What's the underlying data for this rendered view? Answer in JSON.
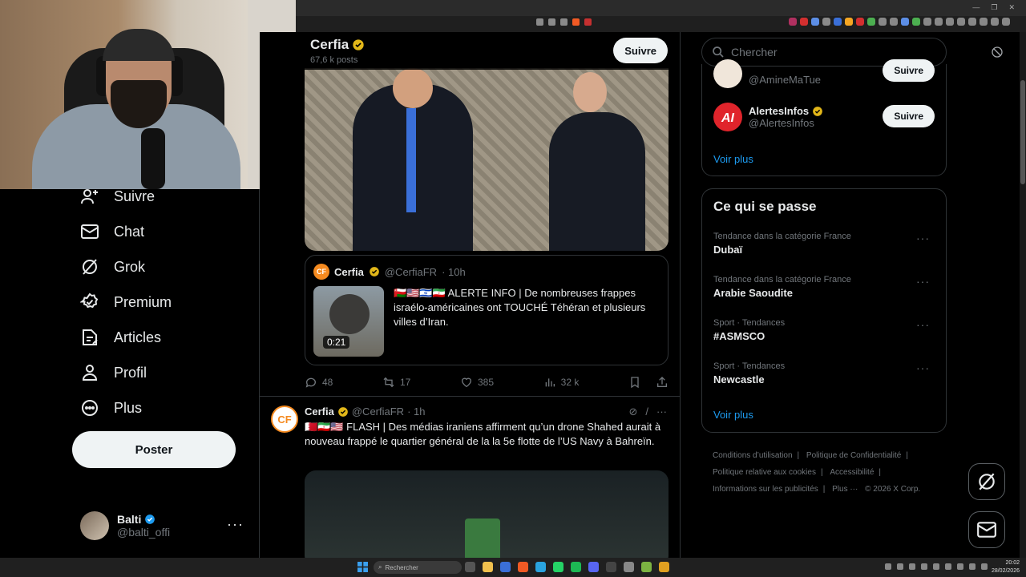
{
  "profile_header": {
    "name": "Cerfia",
    "posts_count": "67,6 k posts",
    "follow_label": "Suivre"
  },
  "nav": {
    "items": [
      {
        "label": "Suivre",
        "icon": "add-user-icon"
      },
      {
        "label": "Chat",
        "icon": "mail-icon"
      },
      {
        "label": "Grok",
        "icon": "grok-icon"
      },
      {
        "label": "Premium",
        "icon": "verified-badge-icon"
      },
      {
        "label": "Articles",
        "icon": "article-icon"
      },
      {
        "label": "Profil",
        "icon": "person-icon"
      },
      {
        "label": "Plus",
        "icon": "more-circle-icon"
      }
    ],
    "post_button": "Poster",
    "account": {
      "name": "Balti",
      "handle": "@balti_offi"
    }
  },
  "quoted_post": {
    "name": "Cerfia",
    "handle": "@CerfiaFR",
    "time": "· 10h",
    "text": "ALERTE INFO | De nombreuses frappes israélo-américaines ont TOUCHÉ Téhéran et plusieurs villes d’Iran.",
    "video_duration": "0:21"
  },
  "post_actions": {
    "replies": "48",
    "reposts": "17",
    "likes": "385",
    "views": "32 k"
  },
  "second_post": {
    "name": "Cerfia",
    "handle": "@CerfiaFR",
    "time": "· 1h",
    "text": "FLASH | Des médias iraniens affirment qu’un drone Shahed aurait à nouveau frappé le quartier général de la la 5e flotte de l’US Navy à Bahreïn."
  },
  "search": {
    "placeholder": "Chercher"
  },
  "who_to_follow": {
    "accounts": [
      {
        "handle": "@AmineMaTue",
        "follow": "Suivre"
      },
      {
        "name": "AlertesInfos",
        "handle": "@AlertesInfos",
        "follow": "Suivre"
      }
    ],
    "more": "Voir plus"
  },
  "trends": {
    "heading": "Ce qui se passe",
    "items": [
      {
        "category": "Tendance dans la catégorie France",
        "name": "Dubaï"
      },
      {
        "category": "Tendance dans la catégorie France",
        "name": "Arabie Saoudite"
      },
      {
        "category": "Sport · Tendances",
        "name": "#ASMSCO"
      },
      {
        "category": "Sport · Tendances",
        "name": "Newcastle"
      }
    ],
    "more": "Voir plus"
  },
  "footer": {
    "links": [
      "Conditions d’utilisation",
      "Politique de Confidentialité",
      "Politique relative aux cookies",
      "Accessibilité",
      "Informations sur les publicités",
      "Plus ···"
    ],
    "copyright": "© 2026 X Corp."
  },
  "taskbar": {
    "search": "Rechercher",
    "time": "20:02",
    "date": "28/02/2026"
  },
  "colors": {
    "accent": "#1d9bf0",
    "verified_gold": "#e2b719",
    "verified_blue": "#1d9bf0",
    "cerfia_orange": "#f58a1f",
    "alertes_red": "#e0242b"
  }
}
